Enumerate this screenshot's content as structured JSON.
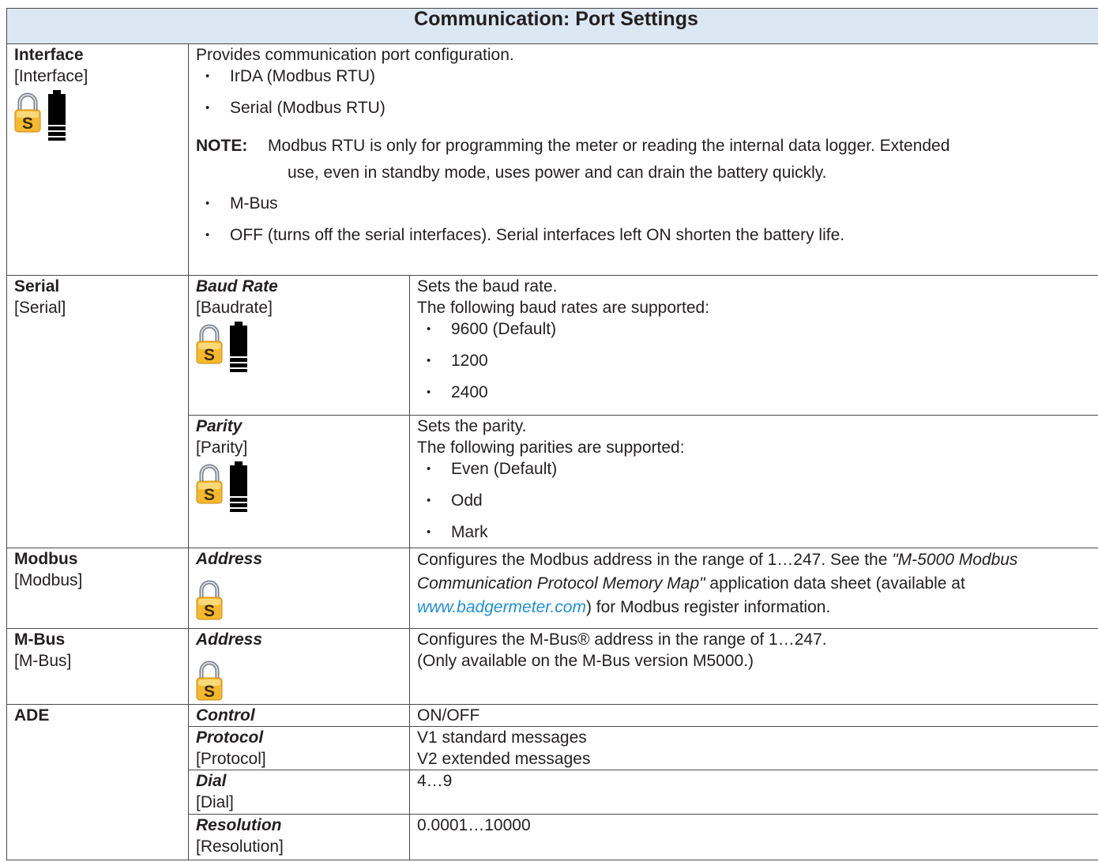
{
  "title": "Communication: Port Settings",
  "icons": {
    "lock": "security-lock-icon",
    "lock_letter": "S",
    "battery": "battery-icon",
    "lock_color": "#f5b92e",
    "header_bg": "#dbe7f3",
    "link_color": "#1f8fd6"
  },
  "interface": {
    "name": "Interface",
    "code": "[Interface]",
    "desc": "Provides communication port configuration.",
    "options1": [
      "IrDA (Modbus RTU)",
      "Serial (Modbus RTU)"
    ],
    "note_label": "NOTE:",
    "note_line1": "Modbus RTU is only for programming the meter or reading the internal data logger. Extended",
    "note_line2": "use, even in standby mode, uses power and can drain the battery quickly.",
    "options2": [
      "M-Bus",
      "OFF (turns off the serial interfaces). Serial interfaces left ON shorten the battery life."
    ]
  },
  "serial": {
    "name": "Serial",
    "code": "[Serial]",
    "baud": {
      "name": "Baud Rate",
      "code": "[Baudrate]",
      "desc1": "Sets the baud rate.",
      "desc2": "The following baud rates are supported:",
      "options": [
        "9600 (Default)",
        "1200",
        "2400"
      ]
    },
    "parity": {
      "name": "Parity",
      "code": "[Parity]",
      "desc1": "Sets the parity.",
      "desc2": "The following parities are supported:",
      "options": [
        "Even (Default)",
        "Odd",
        "Mark"
      ]
    }
  },
  "modbus": {
    "name": "Modbus",
    "code": "[Modbus]",
    "param": "Address",
    "desc_a": "Configures the Modbus address in the range of 1…247. See the ",
    "desc_doc": "\"M-5000 Modbus Communication Protocol Memory Map\"",
    "desc_b": " application data sheet (available at ",
    "desc_link": "www.badgermeter.com",
    "desc_c": ") for Modbus register information."
  },
  "mbus": {
    "name": "M-Bus",
    "code": "[M-Bus]",
    "param": "Address",
    "desc1": "Configures the M-Bus® address in the range of 1…247.",
    "desc2": "(Only available on the M-Bus version M5000.)"
  },
  "ade": {
    "name": "ADE",
    "control": {
      "name": "Control",
      "value": "ON/OFF"
    },
    "protocol": {
      "name": "Protocol",
      "code": "[Protocol]",
      "value1": "V1 standard messages",
      "value2": "V2 extended messages"
    },
    "dial": {
      "name": "Dial",
      "code": "[Dial]",
      "value": "4…9"
    },
    "resolution": {
      "name": "Resolution",
      "code": "[Resolution]",
      "value": "0.0001…10000"
    }
  }
}
